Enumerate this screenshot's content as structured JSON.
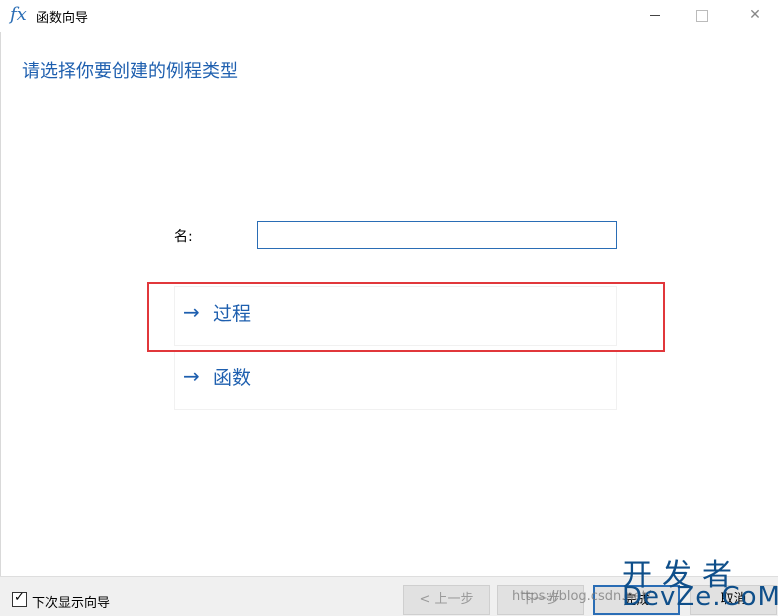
{
  "window": {
    "title": "函数向导",
    "icon": "function-fx-icon",
    "controls": {
      "minimize": "",
      "maximize": "",
      "close": "✕"
    }
  },
  "heading": "请选择你要创建的例程类型",
  "name_field": {
    "label": "名:",
    "value": "",
    "placeholder": ""
  },
  "choices": [
    {
      "arrow": "→",
      "label": "过程",
      "highlighted": true
    },
    {
      "arrow": "→",
      "label": "函数",
      "highlighted": false
    }
  ],
  "footer": {
    "show_wizard_next_time": {
      "checked": true,
      "check": "✓",
      "label": "下次显示向导"
    },
    "buttons": {
      "back": "< 上一步",
      "next": "下一步",
      "finish": "完成",
      "cancel": "取消"
    }
  },
  "watermark": {
    "url": "https://blog.csdn.net/",
    "logo_cn": "开发者",
    "logo_en": "DevZe.CoM"
  },
  "colors": {
    "accent": "#1e5faf",
    "highlight_border": "#e1373b",
    "footer_bg": "#f0f0f0"
  }
}
